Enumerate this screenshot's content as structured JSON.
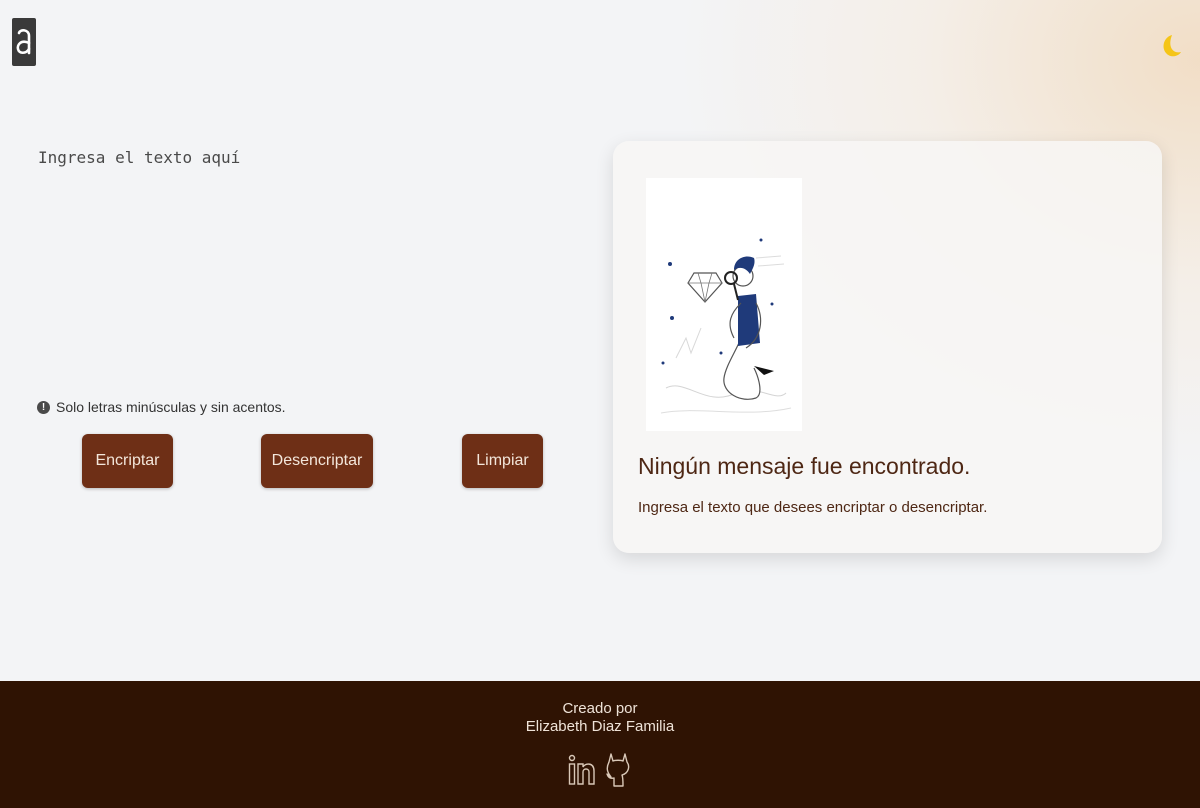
{
  "header": {
    "logo_icon": "logo-a-icon",
    "theme_toggle_icon": "moon-icon",
    "accent_color": "#f5c518"
  },
  "editor": {
    "placeholder": "Ingresa el texto aquí",
    "value": ""
  },
  "hint": {
    "icon": "info-icon",
    "text": "Solo letras minúsculas y sin acentos."
  },
  "buttons": {
    "encrypt": "Encriptar",
    "decrypt": "Desencriptar",
    "clear": "Limpiar",
    "color": "#6e2f16"
  },
  "result": {
    "illustration_icon": "person-magnifying-glass-illustration",
    "title": "Ningún mensaje fue encontrado.",
    "subtitle": "Ingresa el texto que desees encriptar o desencriptar."
  },
  "footer": {
    "created_by": "Creado por",
    "author": "Elizabeth Diaz Familia",
    "links": [
      {
        "icon": "linkedin-icon"
      },
      {
        "icon": "github-icon"
      }
    ],
    "background": "#2f1303"
  }
}
